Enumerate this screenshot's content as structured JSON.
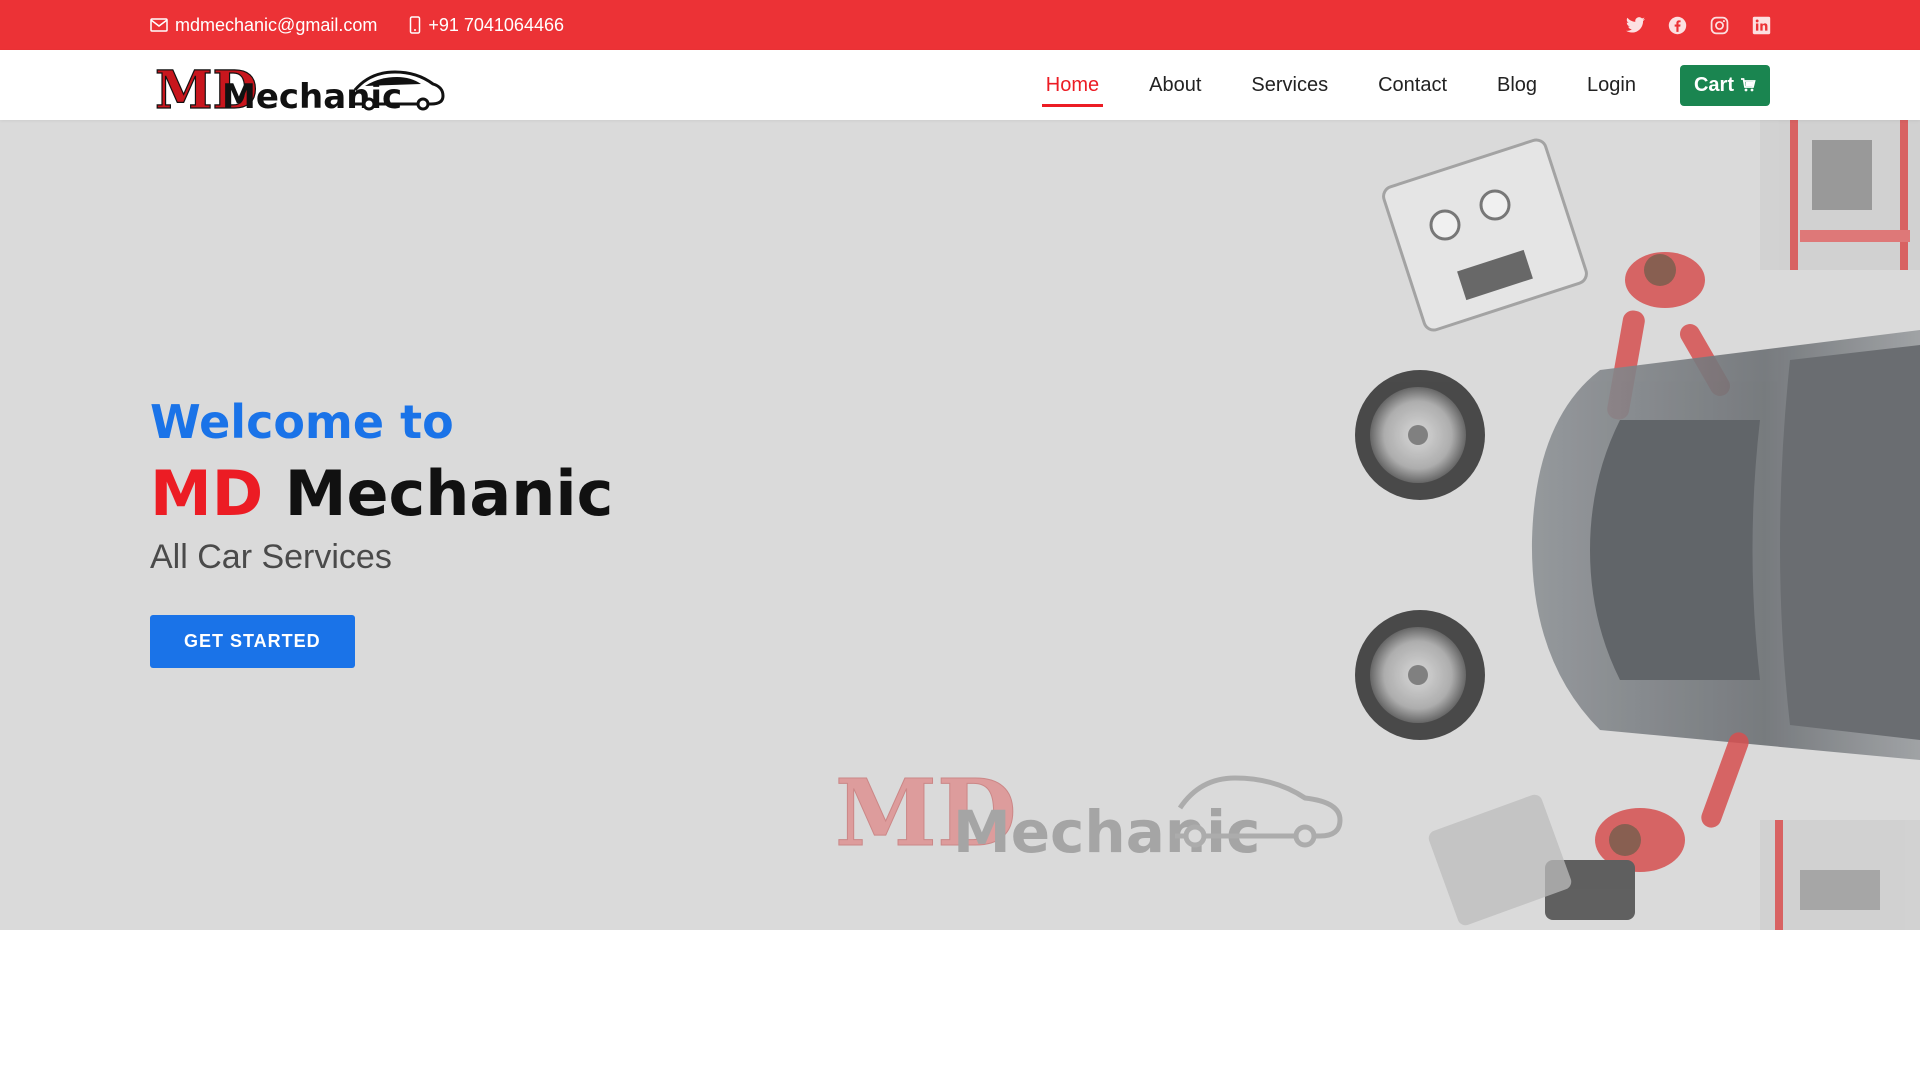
{
  "topbar": {
    "email": "mdmechanic@gmail.com",
    "phone": "+91 7041064466",
    "social_icons": [
      "twitter-icon",
      "facebook-icon",
      "instagram-icon",
      "linkedin-icon"
    ],
    "background": "#ec3236"
  },
  "header": {
    "logo_text_md": "MD",
    "logo_text_name": "Mechanic",
    "nav": [
      {
        "label": "Home",
        "active": true
      },
      {
        "label": "About",
        "active": false
      },
      {
        "label": "Services",
        "active": false
      },
      {
        "label": "Contact",
        "active": false
      },
      {
        "label": "Blog",
        "active": false
      },
      {
        "label": "Login",
        "active": false
      }
    ],
    "cart_label": "Cart",
    "cart_icon": "cart-icon",
    "active_color": "#ec1c24",
    "cart_color": "#1a8550"
  },
  "hero": {
    "welcome": "Welcome to",
    "brand_first": "MD",
    "brand_second": "Mechanic",
    "tagline": "All Car Services",
    "cta_label": "GET STARTED",
    "watermark_md": "MD",
    "watermark_name": "Mechanic",
    "accent": "#1a73e8"
  }
}
